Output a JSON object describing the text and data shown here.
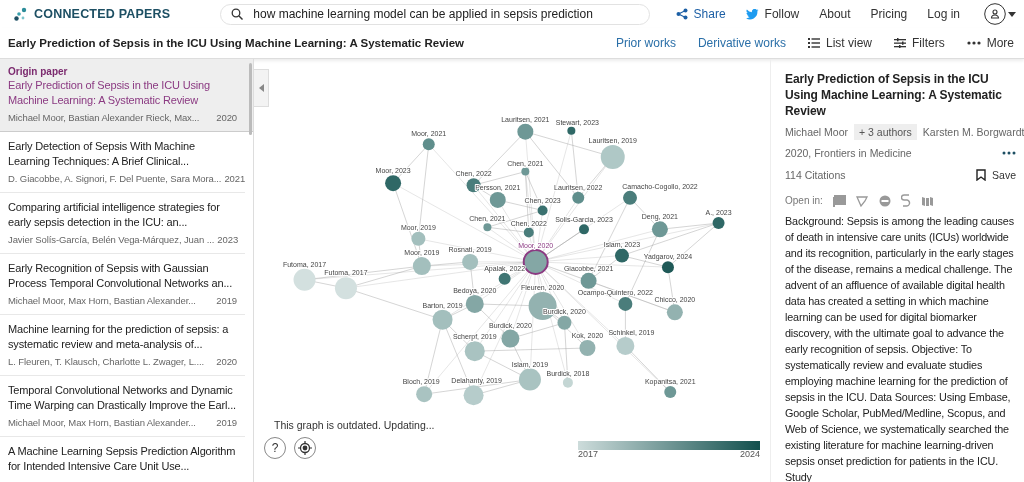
{
  "header": {
    "brand": "CONNECTED PAPERS",
    "search": {
      "value": "how machine learning model can be applied in sepsis prediction"
    },
    "nav": [
      {
        "kind": "share",
        "label": "Share"
      },
      {
        "kind": "follow",
        "label": "Follow"
      },
      {
        "kind": "link",
        "label": "About"
      },
      {
        "kind": "link",
        "label": "Pricing"
      },
      {
        "kind": "link",
        "label": "Log in"
      }
    ]
  },
  "toolbar": {
    "title": "Early Prediction of Sepsis in the ICU Using Machine Learning: A Systematic Review",
    "actions": [
      {
        "kind": "link",
        "label": "Prior works"
      },
      {
        "kind": "link",
        "label": "Derivative works"
      },
      {
        "kind": "list",
        "label": "List view"
      },
      {
        "kind": "filter",
        "label": "Filters"
      },
      {
        "kind": "more",
        "label": "More"
      }
    ]
  },
  "papers": [
    {
      "tag": "Origin paper",
      "title": "Early Prediction of Sepsis in the ICU Using Machine Learning: A Systematic Review",
      "authors": "Michael Moor, Bastian Alexander Rieck, Max...",
      "year": "2020",
      "selected": true
    },
    {
      "title": "Early Detection of Sepsis With Machine Learning Techniques: A Brief Clinical...",
      "authors": "D. Giacobbe, A. Signori, F. Del Puente, Sara Mora...",
      "year": "2021",
      "selected": false
    },
    {
      "title": "Comparing artificial intelligence strategies for early sepsis detection in the ICU: an...",
      "authors": "Javier Solís-García, Belén Vega-Márquez, Juan ...",
      "year": "2023",
      "selected": false
    },
    {
      "title": "Early Recognition of Sepsis with Gaussian Process Temporal Convolutional Networks an...",
      "authors": "Michael Moor, Max Horn, Bastian Alexander...",
      "year": "2019",
      "selected": false
    },
    {
      "title": "Machine learning for the prediction of sepsis: a systematic review and meta-analysis of...",
      "authors": "L. Fleuren, T. Klausch, Charlotte L. Zwager, L....",
      "year": "2020",
      "selected": false
    },
    {
      "title": "Temporal Convolutional Networks and Dynamic Time Warping can Drastically Improve the Earl...",
      "authors": "Michael Moor, Max Horn, Bastian Alexander...",
      "year": "2019",
      "selected": false
    },
    {
      "title": "A Machine Learning Sepsis Prediction Algorithm for Intended Intensive Care Unit Use...",
      "selected": false
    }
  ],
  "graph": {
    "nodes": [
      {
        "label": "Lauritsen, 2021",
        "color": "#6e9896",
        "selected": false
      },
      {
        "label": "Stewart, 2023",
        "color": "#2f6866",
        "selected": false
      },
      {
        "label": "Lauritsen, 2019",
        "color": "#afc8c6",
        "selected": false
      },
      {
        "label": "Moor, 2021",
        "color": "#5f8e8c",
        "selected": false
      },
      {
        "label": "Moor, 2023",
        "color": "#2f6866",
        "selected": false
      },
      {
        "label": "Chen, 2022",
        "color": "#4a7d7b",
        "selected": false
      },
      {
        "label": "Chen, 2021",
        "color": "#6e9896",
        "selected": false
      },
      {
        "label": "Persson, 2021",
        "color": "#6e9896",
        "selected": false
      },
      {
        "label": "Lauritsen, 2022",
        "color": "#5f8e8c",
        "selected": false
      },
      {
        "label": "Camacho-Cogollo, 2022",
        "color": "#4a7d7b",
        "selected": false
      },
      {
        "label": "Chen, 2023",
        "color": "#3a716f",
        "selected": false
      },
      {
        "label": "Chen, 2021",
        "color": "#6e9896",
        "selected": false
      },
      {
        "label": "Chen, 2022",
        "color": "#4a7d7b",
        "selected": false
      },
      {
        "label": "Solis-Garcia, 2023",
        "color": "#2f6866",
        "selected": false
      },
      {
        "label": "Deng, 2021",
        "color": "#6e9896",
        "selected": false
      },
      {
        "label": "A., 2023",
        "color": "#2f6866",
        "selected": false
      },
      {
        "label": "Moor, 2019",
        "color": "#a3bfbd",
        "selected": false
      },
      {
        "label": "Moor, 2019",
        "color": "#a3bfbd",
        "selected": false
      },
      {
        "label": "Rosnati, 2019",
        "color": "#a3bfbd",
        "selected": false
      },
      {
        "label": "Moor, 2020",
        "color": "#84a7a5",
        "selected": true
      },
      {
        "label": "Apalak, 2022",
        "color": "#3f7573",
        "selected": false
      },
      {
        "label": "Islam, 2023",
        "color": "#2f6866",
        "selected": false
      },
      {
        "label": "Yadgarov, 2024",
        "color": "#1f5957",
        "selected": false
      },
      {
        "label": "Futoma, 2017",
        "color": "#d3e0df",
        "selected": false
      },
      {
        "label": "Futoma, 2017",
        "color": "#d3e0df",
        "selected": false
      },
      {
        "label": "Giacobbe, 2021",
        "color": "#6e9896",
        "selected": false
      },
      {
        "label": "Bedoya, 2020",
        "color": "#84a7a5",
        "selected": false
      },
      {
        "label": "Fleuren, 2020",
        "color": "#93b2b0",
        "selected": false
      },
      {
        "label": "Ocampo-Quintero, 2022",
        "color": "#4a7d7b",
        "selected": false
      },
      {
        "label": "Chicco, 2020",
        "color": "#93b2b0",
        "selected": false
      },
      {
        "label": "Barton, 2019",
        "color": "#a3bfbd",
        "selected": false
      },
      {
        "label": "Burdick, 2020",
        "color": "#84a7a5",
        "selected": false
      },
      {
        "label": "Burdick, 2020",
        "color": "#84a7a5",
        "selected": false
      },
      {
        "label": "Kok, 2020",
        "color": "#93b2b0",
        "selected": false
      },
      {
        "label": "Schinkel, 2019",
        "color": "#b6cccb",
        "selected": false
      },
      {
        "label": "Scherpf, 2019",
        "color": "#a9c3c1",
        "selected": false
      },
      {
        "label": "Islam, 2019",
        "color": "#a9c3c1",
        "selected": false
      },
      {
        "label": "Burdick, 2018",
        "color": "#c4d6d4",
        "selected": false
      },
      {
        "label": "Bloch, 2019",
        "color": "#a9c3c1",
        "selected": false
      },
      {
        "label": "Delahanty, 2019",
        "color": "#b6cccb",
        "selected": false
      },
      {
        "label": "Kopanitsa, 2021",
        "color": "#6e9896",
        "selected": false
      }
    ],
    "status": "This graph is outdated. Updating...",
    "help": "?",
    "legend": {
      "start": "2017",
      "end": "2024"
    }
  },
  "details": {
    "title": "Early Prediction of Sepsis in the ICU Using Machine Learning: A Systematic Review",
    "first_author": "Michael Moor",
    "more_authors": "+ 3 authors",
    "last_author": "Karsten M. Borgwardt",
    "venue": "2020, Frontiers in Medicine",
    "citations": "114 Citations",
    "save": "Save",
    "open_in": "Open in:",
    "abstract": "Background: Sepsis is among the leading causes of death in intensive care units (ICUs) worldwide and its recognition, particularly in the early stages of the disease, remains a medical challenge. The advent of an affluence of available digital health data has created a setting in which machine learning can be used for digital biomarker discovery, with the ultimate goal to advance the early recognition of sepsis. Objective: To systematically review and evaluate studies employing machine learning for the prediction of sepsis in the ICU. Data Sources: Using Embase, Google Scholar, PubMed/Medline, Scopus, and Web of Science, we systematically searched the existing literature for machine learning-driven sepsis onset prediction for patients in the ICU. Study"
  }
}
